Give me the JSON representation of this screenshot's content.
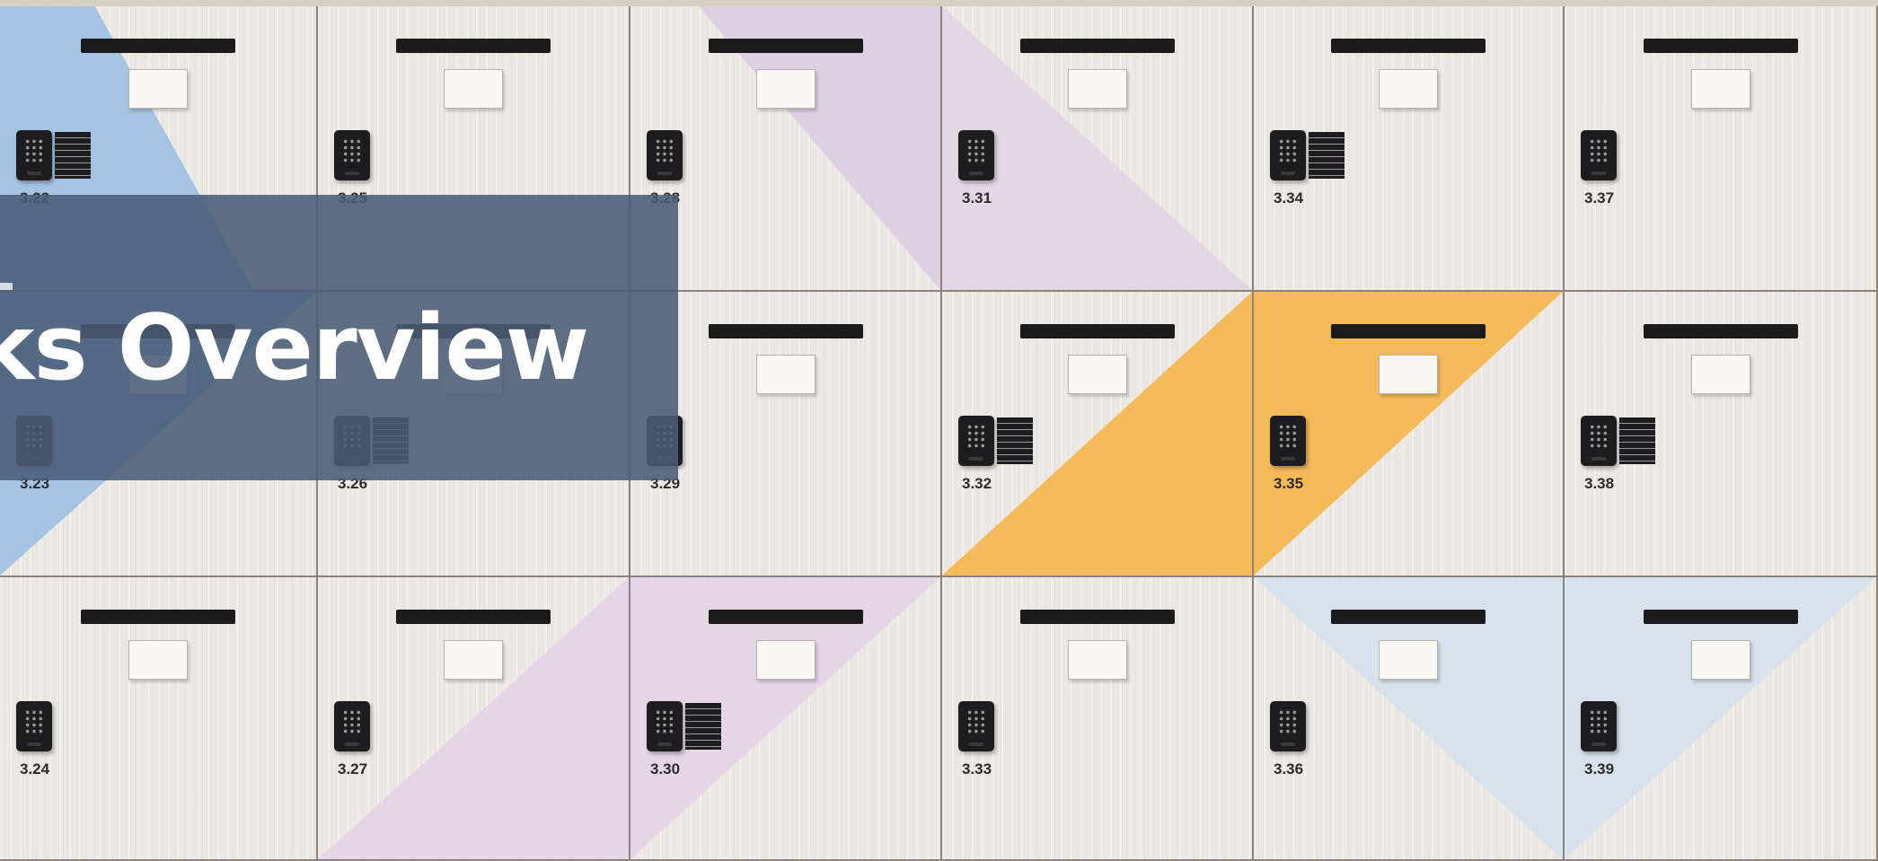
{
  "banner": {
    "title": "cks Overview"
  },
  "lockers": [
    {
      "number": "3.22",
      "accent": "#9fc0e3",
      "shape": "blue-left",
      "instruction_card": true
    },
    {
      "number": "3.25",
      "accent": null,
      "shape": "none",
      "instruction_card": false
    },
    {
      "number": "3.28",
      "accent": "#d9cfe3",
      "shape": "lilac-top",
      "instruction_card": false
    },
    {
      "number": "3.31",
      "accent": "#e1d6e6",
      "shape": "lilac-left",
      "instruction_card": false
    },
    {
      "number": "3.34",
      "accent": null,
      "shape": "none",
      "instruction_card": true
    },
    {
      "number": "3.37",
      "accent": null,
      "shape": "none",
      "instruction_card": false
    },
    {
      "number": "3.23",
      "accent": "#9fc0e3",
      "shape": "blue-left2",
      "instruction_card": false
    },
    {
      "number": "3.26",
      "accent": null,
      "shape": "none",
      "instruction_card": true
    },
    {
      "number": "3.29",
      "accent": null,
      "shape": "none",
      "instruction_card": false
    },
    {
      "number": "3.32",
      "accent": "#f6b64c",
      "shape": "orange-a",
      "instruction_card": true
    },
    {
      "number": "3.35",
      "accent": "#f6b64c",
      "shape": "orange-b",
      "instruction_card": false
    },
    {
      "number": "3.38",
      "accent": null,
      "shape": "none",
      "instruction_card": true
    },
    {
      "number": "3.24",
      "accent": null,
      "shape": "none",
      "instruction_card": false
    },
    {
      "number": "3.27",
      "accent": "#e6d3e8",
      "shape": "pink-right",
      "instruction_card": false
    },
    {
      "number": "3.30",
      "accent": "#e6d3e8",
      "shape": "pink-top",
      "instruction_card": true
    },
    {
      "number": "3.33",
      "accent": null,
      "shape": "none",
      "instruction_card": false
    },
    {
      "number": "3.36",
      "accent": "#d6e2ee",
      "shape": "lightblue-a",
      "instruction_card": false
    },
    {
      "number": "3.39",
      "accent": "#d6e2ee",
      "shape": "lightblue-b",
      "instruction_card": false
    }
  ]
}
